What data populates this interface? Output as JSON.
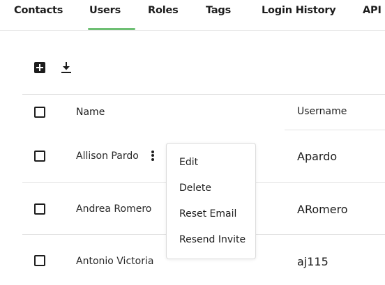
{
  "tabs": [
    {
      "label": "Contacts"
    },
    {
      "label": "Users",
      "active": true
    },
    {
      "label": "Roles"
    },
    {
      "label": "Tags"
    },
    {
      "label": "Login History"
    },
    {
      "label": "API"
    }
  ],
  "toolbar": {
    "add_icon": "plus-square-icon",
    "download_icon": "download-icon"
  },
  "table": {
    "columns": [
      "Name",
      "Username"
    ],
    "rows": [
      {
        "name": "Allison Pardo",
        "username": "Apardo"
      },
      {
        "name": "Andrea Romero",
        "username": "ARomero"
      },
      {
        "name": "Antonio Victoria",
        "username": "aj115"
      }
    ]
  },
  "context_menu": {
    "items": [
      "Edit",
      "Delete",
      "Reset Email",
      "Resend Invite"
    ]
  },
  "colors": {
    "accent": "#6dbf73",
    "text": "#1d1d1d",
    "divider": "#e3e3e3"
  }
}
